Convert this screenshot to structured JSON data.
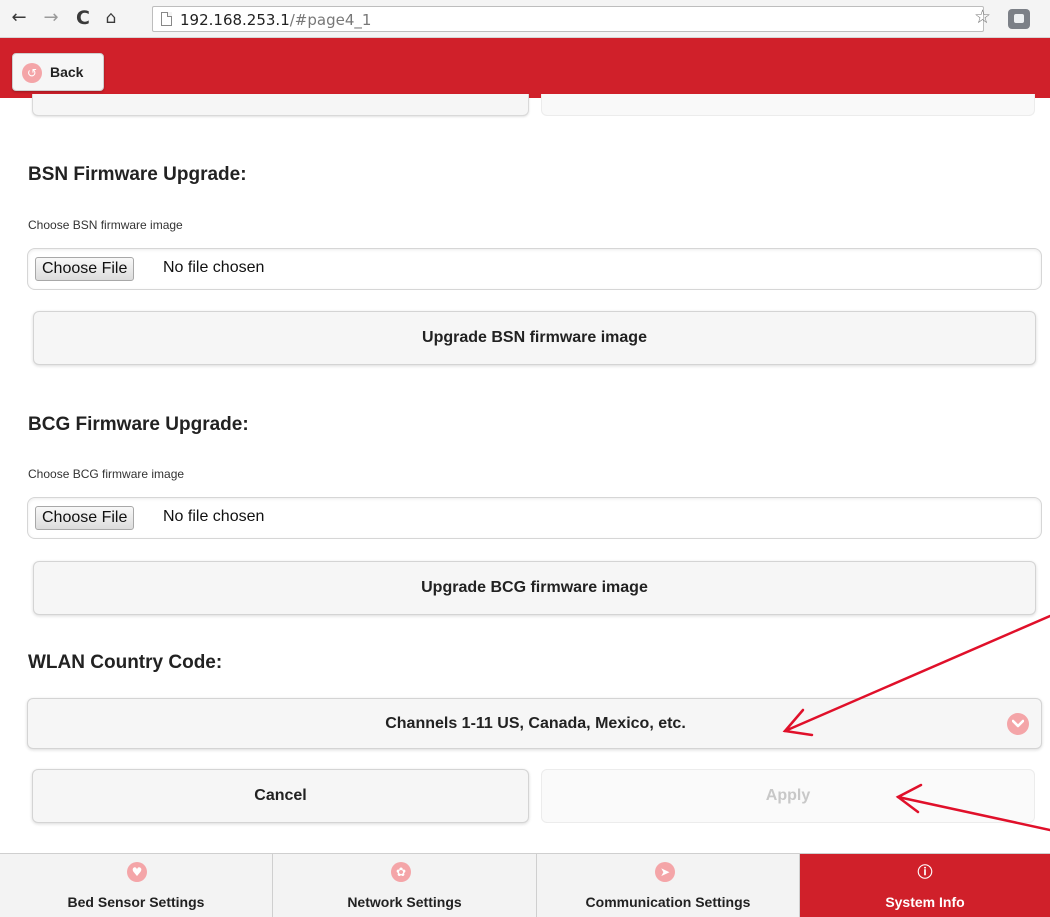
{
  "browser": {
    "url_host": "192.168.253.1",
    "url_path": "/#page4_1",
    "icons": {
      "back": "arrow-left",
      "forward": "arrow-right",
      "reload": "reload",
      "home": "home",
      "bookmark": "star-outline",
      "extension": "extension"
    }
  },
  "header": {
    "back_label": "Back",
    "accent": "#d0202a"
  },
  "bsn": {
    "title": "BSN Firmware Upgrade:",
    "label": "Choose BSN firmware image",
    "choose_label": "Choose File",
    "file_status": "No file chosen",
    "upgrade_label": "Upgrade BSN firmware image"
  },
  "bcg": {
    "title": "BCG Firmware Upgrade:",
    "label": "Choose BCG firmware image",
    "choose_label": "Choose File",
    "file_status": "No file chosen",
    "upgrade_label": "Upgrade BCG firmware image"
  },
  "wlan": {
    "title": "WLAN Country Code:",
    "selected": "Channels 1-11 US, Canada, Mexico, etc."
  },
  "actions": {
    "cancel_label": "Cancel",
    "apply_label": "Apply",
    "apply_enabled": false
  },
  "tabs": [
    {
      "label": "Bed Sensor Settings",
      "icon": "heart-icon",
      "active": false
    },
    {
      "label": "Network Settings",
      "icon": "gear-icon",
      "active": false
    },
    {
      "label": "Communication Settings",
      "icon": "navigation-icon",
      "active": false
    },
    {
      "label": "System Info",
      "icon": "info-icon",
      "active": true
    }
  ],
  "annotation_color": "#e0102a"
}
